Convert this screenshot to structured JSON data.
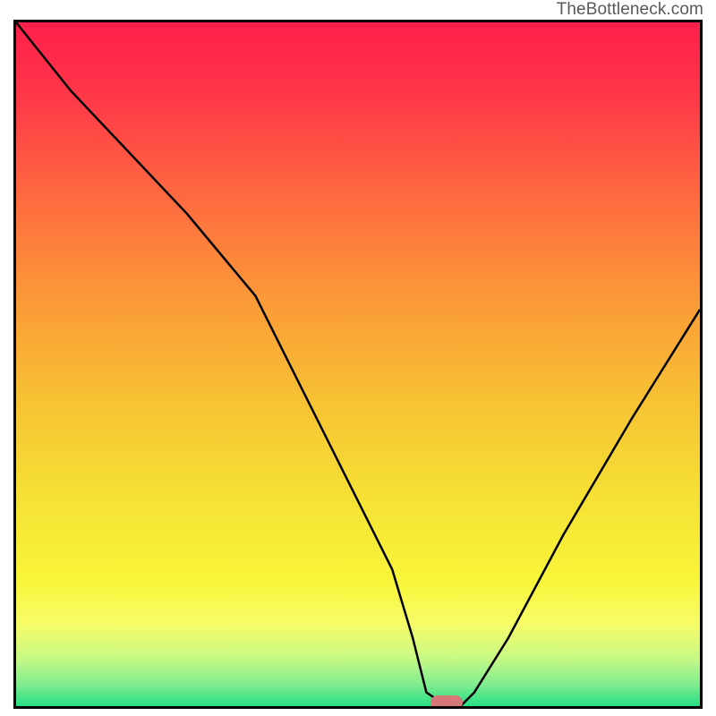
{
  "watermark": "TheBottleneck.com",
  "chart_data": {
    "type": "line",
    "title": "",
    "xlabel": "",
    "ylabel": "",
    "xlim": [
      0,
      100
    ],
    "ylim": [
      0,
      100
    ],
    "series": [
      {
        "name": "bottleneck-curve",
        "x": [
          0,
          8,
          25,
          35,
          55,
          58,
          60,
          63,
          65,
          67,
          72,
          80,
          90,
          100
        ],
        "values": [
          100,
          90,
          72,
          60,
          20,
          10,
          2,
          0,
          0,
          2,
          10,
          25,
          42,
          58
        ]
      }
    ],
    "marker": {
      "name": "optimal-point",
      "x": 63,
      "y": 0,
      "color": "#d6787a"
    },
    "gradient_stops": [
      {
        "pos": 0.0,
        "color": "#ff1f4b"
      },
      {
        "pos": 0.1,
        "color": "#ff3549"
      },
      {
        "pos": 0.25,
        "color": "#fe6840"
      },
      {
        "pos": 0.4,
        "color": "#fb9838"
      },
      {
        "pos": 0.55,
        "color": "#f7c133"
      },
      {
        "pos": 0.7,
        "color": "#f6e234"
      },
      {
        "pos": 0.82,
        "color": "#f8f63a"
      },
      {
        "pos": 0.88,
        "color": "#f7fc69"
      },
      {
        "pos": 0.93,
        "color": "#c7f985"
      },
      {
        "pos": 0.97,
        "color": "#7cec8f"
      },
      {
        "pos": 1.0,
        "color": "#26de85"
      }
    ]
  }
}
